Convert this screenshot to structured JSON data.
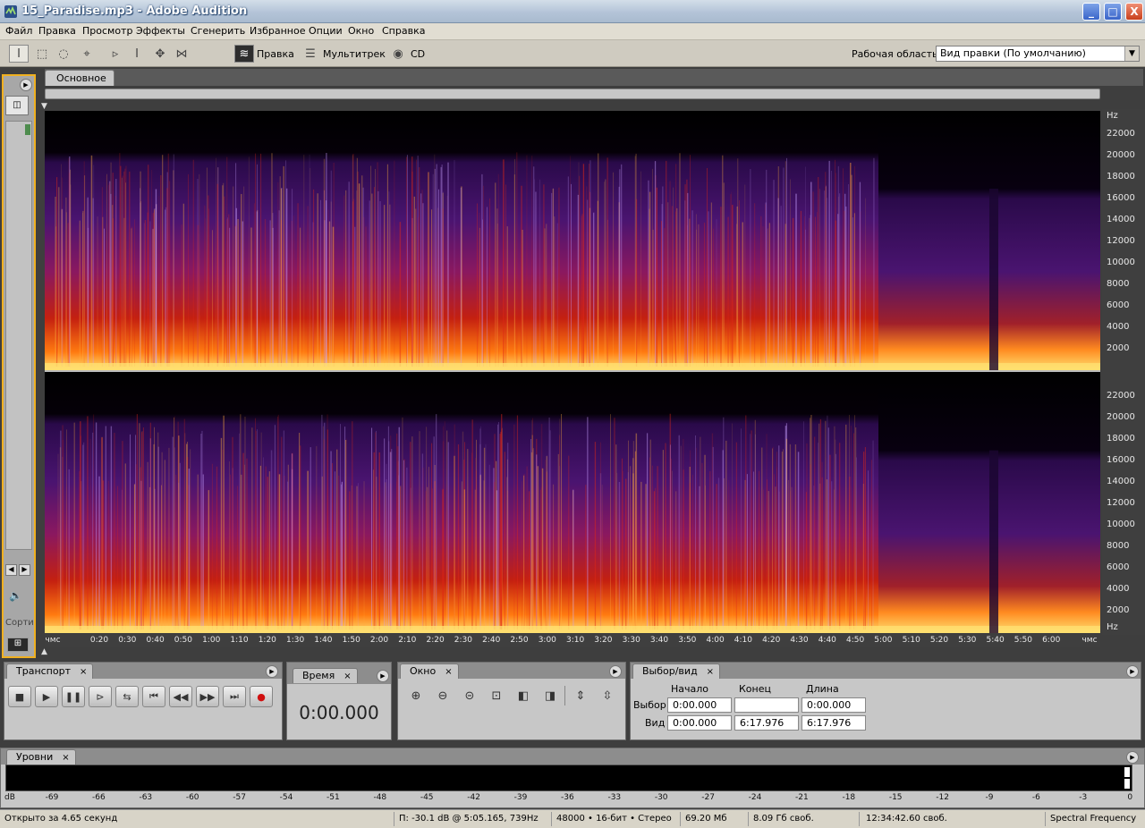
{
  "window": {
    "title": "15_Paradise.mp3 - Adobe Audition",
    "minimize": "_",
    "maximize": "□",
    "close": "X"
  },
  "menu": [
    "Файл",
    "Правка",
    "Просмотр",
    "Эффекты",
    "Сгенерить",
    "Избранное",
    "Опции",
    "Окно",
    "Справка"
  ],
  "toolbar": {
    "edit_label": "Правка",
    "multitrack_label": "Мультитрек",
    "cd_label": "CD",
    "workspace_label": "Рабочая область:",
    "workspace_value": "Вид правки (По умолчанию)"
  },
  "left_panel": {
    "sort_label": "Сорти"
  },
  "main_tab": "Основное",
  "freq_axis": {
    "unit": "Hz",
    "ticks": [
      "22000",
      "20000",
      "18000",
      "16000",
      "14000",
      "12000",
      "10000",
      "8000",
      "6000",
      "4000",
      "2000"
    ]
  },
  "time_axis": {
    "unit": "чмс",
    "ticks": [
      "0:20",
      "0:30",
      "0:40",
      "0:50",
      "1:00",
      "1:10",
      "1:20",
      "1:30",
      "1:40",
      "1:50",
      "2:00",
      "2:10",
      "2:20",
      "2:30",
      "2:40",
      "2:50",
      "3:00",
      "3:10",
      "3:20",
      "3:30",
      "3:40",
      "3:50",
      "4:00",
      "4:10",
      "4:20",
      "4:30",
      "4:40",
      "4:50",
      "5:00",
      "5:10",
      "5:20",
      "5:30",
      "5:40",
      "5:50",
      "6:00"
    ]
  },
  "transport": {
    "tab": "Транспорт",
    "close": "×"
  },
  "time_panel": {
    "tab": "Время",
    "close": "×",
    "value": "0:00.000"
  },
  "zoom_panel": {
    "tab": "Окно",
    "close": "×"
  },
  "selection_panel": {
    "tab": "Выбор/вид",
    "close": "×",
    "col_start": "Начало",
    "col_end": "Конец",
    "col_length": "Длина",
    "row_selection": "Выбор",
    "row_view": "Вид",
    "sel_start": "0:00.000",
    "sel_end": "",
    "sel_length": "0:00.000",
    "view_start": "0:00.000",
    "view_end": "6:17.976",
    "view_length": "6:17.976"
  },
  "levels": {
    "tab": "Уровни",
    "close": "×",
    "unit": "dB",
    "ticks": [
      "-69",
      "-66",
      "-63",
      "-60",
      "-57",
      "-54",
      "-51",
      "-48",
      "-45",
      "-42",
      "-39",
      "-36",
      "-33",
      "-30",
      "-27",
      "-24",
      "-21",
      "-18",
      "-15",
      "-12",
      "-9",
      "-6",
      "-3",
      "0"
    ]
  },
  "status": {
    "opened": "Открыто за 4.65 секунд",
    "cursor": "П: -30.1 dB @   5:05.165, 739Hz",
    "format": "48000 • 16-бит • Стерео",
    "size": "69.20 Мб",
    "free": "8.09 Гб своб.",
    "free_time": "12:34:42.60 своб.",
    "view_mode": "Spectral Frequency"
  },
  "colors": {
    "accent_outline": "#f0b020",
    "spectrogram_low": "#2a0a4a",
    "spectrogram_mid": "#d21f10",
    "spectrogram_high": "#ffe070"
  }
}
